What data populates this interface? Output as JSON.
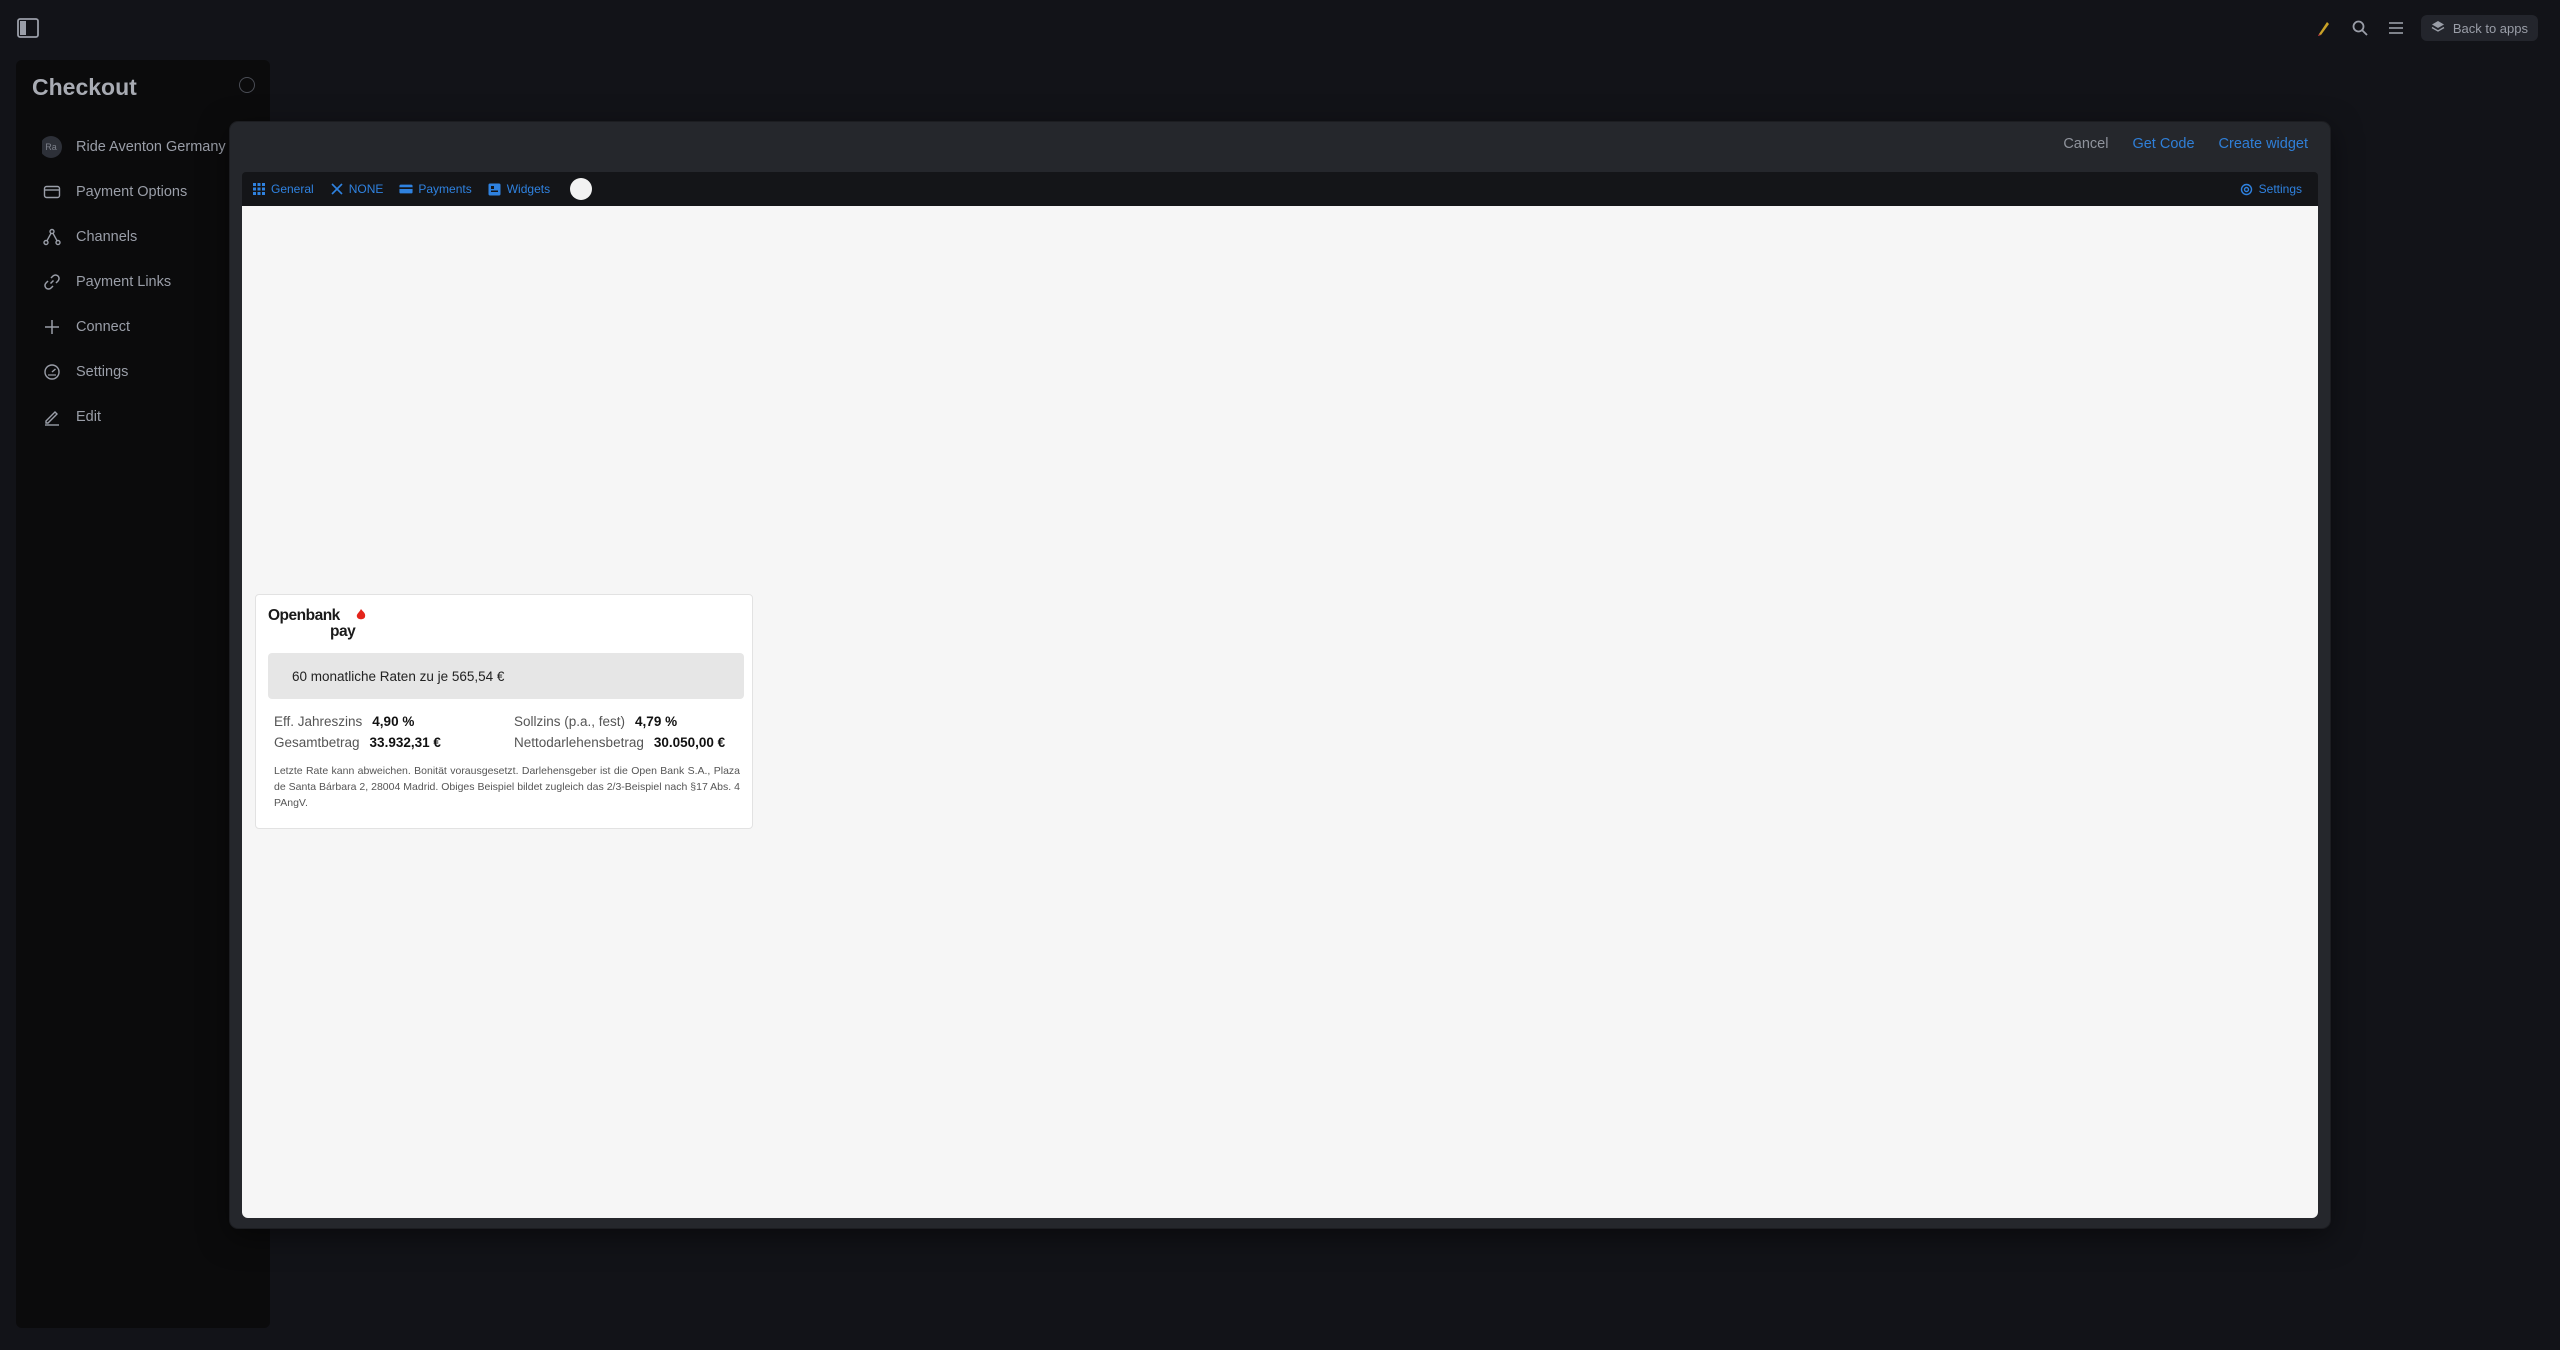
{
  "topbar": {
    "back_label": "Back to apps"
  },
  "panel": {
    "title": "Checkout",
    "items": [
      {
        "label": "Ride Aventon Germany G",
        "icon": "avatar",
        "avatar_initials": "Ra"
      },
      {
        "label": "Payment Options",
        "icon": "credit-card-icon"
      },
      {
        "label": "Channels",
        "icon": "network-icon"
      },
      {
        "label": "Payment Links",
        "icon": "link-icon"
      },
      {
        "label": "Connect",
        "icon": "plus-icon"
      },
      {
        "label": "Settings",
        "icon": "gauge-icon"
      },
      {
        "label": "Edit",
        "icon": "pen-icon"
      }
    ]
  },
  "modal": {
    "actions": {
      "cancel": "Cancel",
      "get_code": "Get Code",
      "create_widget": "Create widget"
    },
    "tabs": [
      {
        "label": "General",
        "icon": "grid-icon"
      },
      {
        "label": "NONE",
        "icon": "close-icon"
      },
      {
        "label": "Payments",
        "icon": "card-icon"
      },
      {
        "label": "Widgets",
        "icon": "widget-icon"
      }
    ],
    "settings_label": "Settings",
    "accent_color": "#2f82e0"
  },
  "widget": {
    "logo_line1": "Openbank",
    "logo_line2": "pay",
    "rate_text": "60 monatliche Raten zu je 565,54 €",
    "details": {
      "eff_label": "Eff. Jahreszins",
      "eff_value": "4,90 %",
      "soll_label": "Sollzins (p.a., fest)",
      "soll_value": "4,79 %",
      "gesamt_label": "Gesamtbetrag",
      "gesamt_value": "33.932,31 €",
      "netto_label": "Nettodarlehensbetrag",
      "netto_value": "30.050,00 €"
    },
    "disclaimer": "Letzte Rate kann abweichen. Bonität vorausgesetzt. Darlehensgeber ist die Open Bank S.A., Plaza de Santa Bárbara 2, 28004 Madrid. Obiges Beispiel bildet zugleich das 2/3-Beispiel nach §17 Abs. 4 PAngV."
  }
}
